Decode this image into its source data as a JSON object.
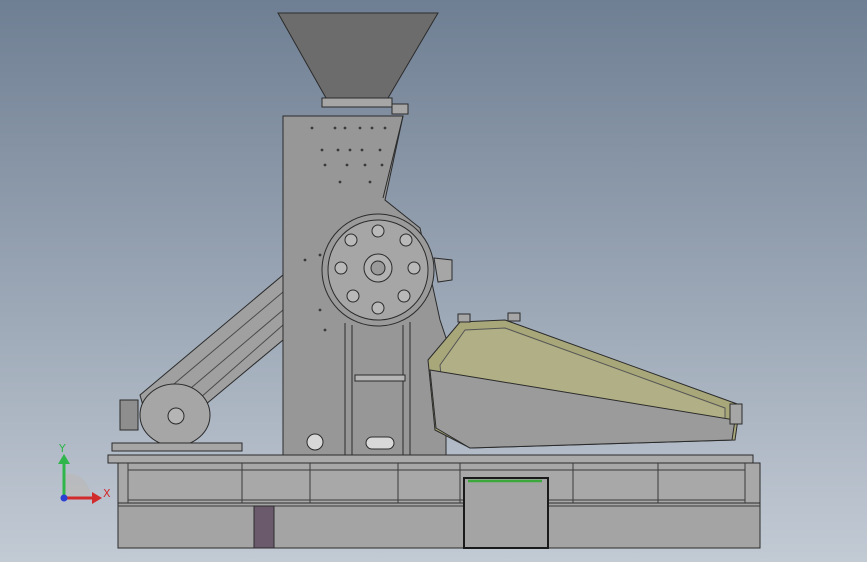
{
  "viewport": {
    "background_top": "#6f7f93",
    "background_bottom": "#c2cad4"
  },
  "colors": {
    "machine": "#979797",
    "machine_light": "#a6a6a6",
    "machine_dark": "#7d7d7d",
    "edge": "#2b2b2b",
    "belt_guard": "#a8a77a",
    "pit_line": "#3aa83a",
    "purple_block": "#6a5a6c",
    "hopper": "#6c6c6c"
  },
  "triad": {
    "x_label": "X",
    "y_label": "Y",
    "x_color": "#d22b2b",
    "y_color": "#2fb64a",
    "z_color": "#2b3fd2"
  }
}
